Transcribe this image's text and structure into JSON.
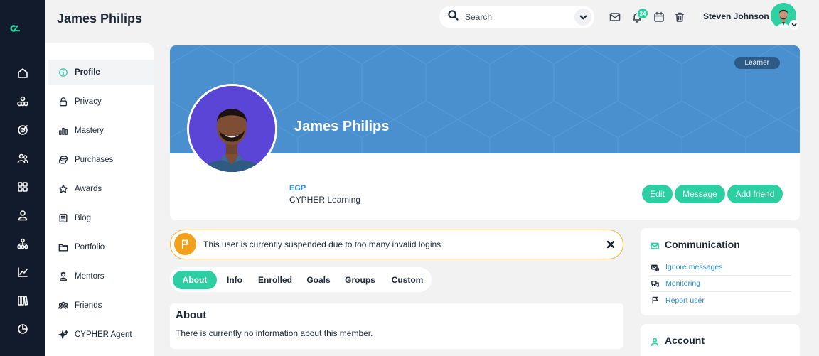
{
  "header": {
    "page_title": "James Philips",
    "search": {
      "placeholder": "Search"
    },
    "notifications_count": "34",
    "user_name": "Steven Johnson"
  },
  "rail": {
    "icons": [
      "home-icon",
      "network-icon",
      "target-icon",
      "users-icon",
      "grid-icon",
      "user-icon",
      "hierarchy-icon",
      "chart-line-icon",
      "library-icon",
      "pie-chart-icon"
    ]
  },
  "sidenav": {
    "items": [
      {
        "label": "Profile",
        "icon": "info-icon",
        "active": true
      },
      {
        "label": "Privacy",
        "icon": "lock-icon"
      },
      {
        "label": "Mastery",
        "icon": "bar-chart-icon"
      },
      {
        "label": "Purchases",
        "icon": "coins-icon"
      },
      {
        "label": "Awards",
        "icon": "star-icon"
      },
      {
        "label": "Blog",
        "icon": "document-icon"
      },
      {
        "label": "Portfolio",
        "icon": "folder-icon"
      },
      {
        "label": "Mentors",
        "icon": "mentor-icon"
      },
      {
        "label": "Friends",
        "icon": "friends-icon"
      },
      {
        "label": "CYPHER Agent",
        "icon": "sparkle-icon"
      }
    ]
  },
  "profile": {
    "name": "James Philips",
    "role_badge": "Learner",
    "org_code": "EGP",
    "org_name": "CYPHER Learning",
    "actions": {
      "edit": "Edit",
      "message": "Message",
      "add_friend": "Add friend"
    }
  },
  "alert": {
    "message": "This user is currently suspended due to too many invalid logins"
  },
  "tabs": [
    "About",
    "Info",
    "Enrolled",
    "Goals",
    "Groups",
    "Custom"
  ],
  "about": {
    "heading": "About",
    "text": "There is currently no information about this member."
  },
  "communication": {
    "title": "Communication",
    "links": [
      {
        "label": "Ignore messages",
        "icon": "mail-block-icon"
      },
      {
        "label": "Monitoring",
        "icon": "chat-icon"
      },
      {
        "label": "Report user",
        "icon": "flag-icon"
      }
    ]
  },
  "account": {
    "title": "Account"
  },
  "colors": {
    "accent": "#2ccfa1",
    "rail": "#121b2c",
    "cover": "#4a90cf",
    "link": "#2a8fd4",
    "warning": "#f2a11c"
  }
}
